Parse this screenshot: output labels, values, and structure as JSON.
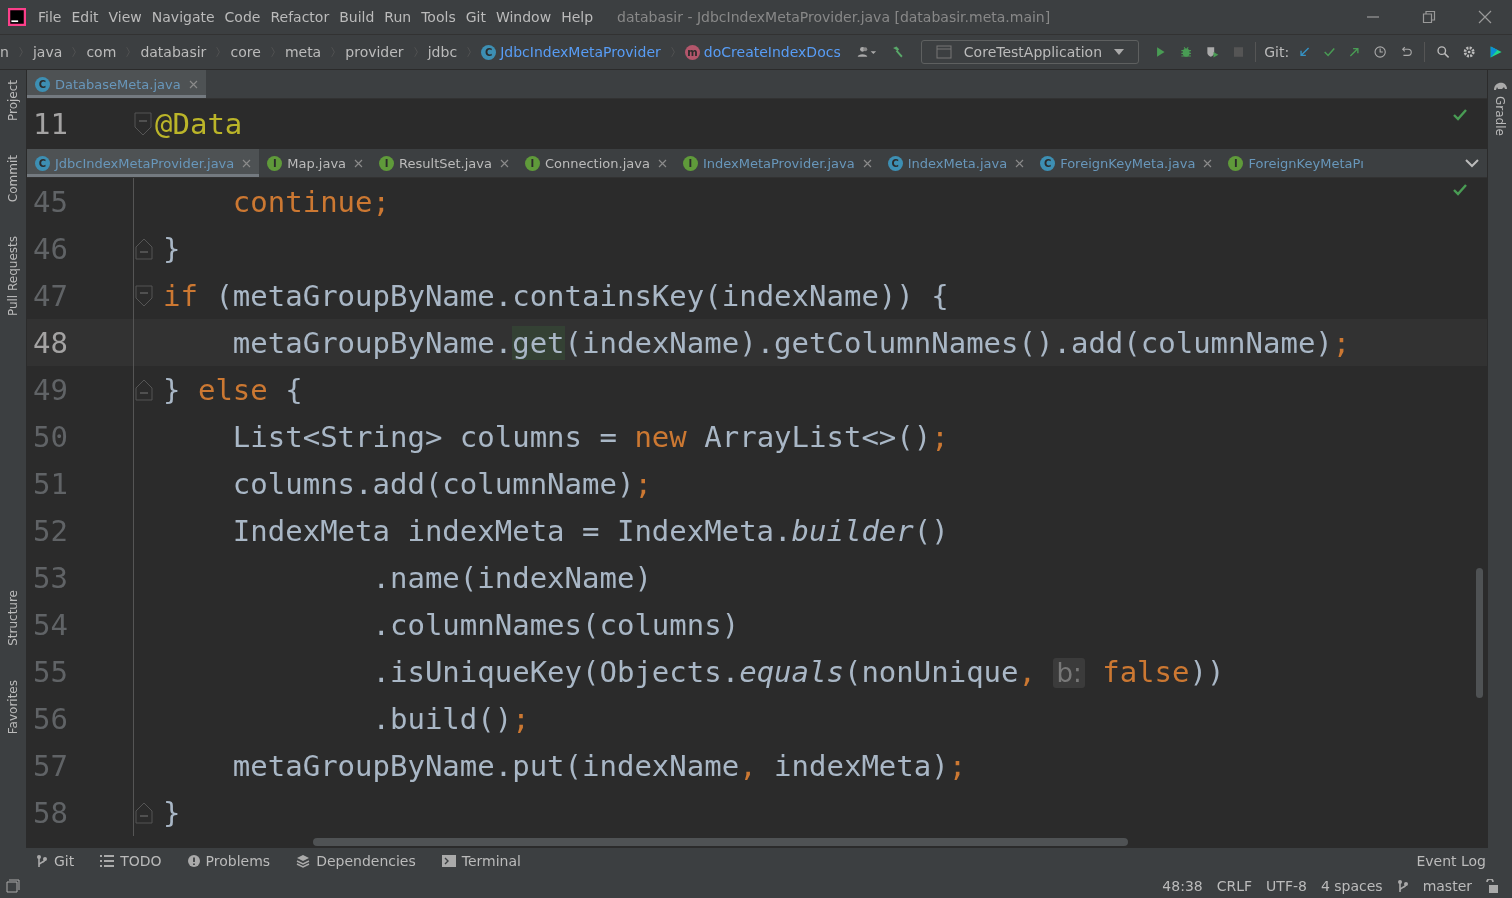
{
  "window": {
    "title": "databasir - JdbcIndexMetaProvider.java [databasir.meta.main]"
  },
  "menu": [
    "File",
    "Edit",
    "View",
    "Navigate",
    "Code",
    "Refactor",
    "Build",
    "Run",
    "Tools",
    "Git",
    "Window",
    "Help"
  ],
  "breadcrumbs": [
    {
      "label": "n",
      "kind": "folder"
    },
    {
      "label": "java",
      "kind": "folder"
    },
    {
      "label": "com",
      "kind": "folder"
    },
    {
      "label": "databasir",
      "kind": "folder"
    },
    {
      "label": "core",
      "kind": "folder"
    },
    {
      "label": "meta",
      "kind": "folder"
    },
    {
      "label": "provider",
      "kind": "folder"
    },
    {
      "label": "jdbc",
      "kind": "folder"
    },
    {
      "label": "JdbcIndexMetaProvider",
      "kind": "class",
      "badge": "C"
    },
    {
      "label": "doCreateIndexDocs",
      "kind": "method",
      "badge": "m"
    }
  ],
  "toolbar": {
    "run_configuration": "CoreTestApplication",
    "git_label": "Git:"
  },
  "left_tools": [
    "Project",
    "Commit",
    "Pull Requests",
    "Structure",
    "Favorites"
  ],
  "right_tools": [
    "Gradle"
  ],
  "top_editor": {
    "tabs": [
      {
        "label": "DatabaseMeta.java",
        "kind": "class",
        "badge": "C",
        "modified": true,
        "selected": true
      }
    ],
    "sticky_line": {
      "number": "11",
      "text": "@Data"
    }
  },
  "editor": {
    "tabs": [
      {
        "label": "JdbcIndexMetaProvider.java",
        "kind": "class",
        "badge": "C",
        "modified": true,
        "selected": true
      },
      {
        "label": "Map.java",
        "kind": "interface",
        "badge": "I",
        "modified": false,
        "selected": false
      },
      {
        "label": "ResultSet.java",
        "kind": "interface",
        "badge": "I",
        "modified": false,
        "selected": false
      },
      {
        "label": "Connection.java",
        "kind": "interface",
        "badge": "I",
        "modified": false,
        "selected": false
      },
      {
        "label": "IndexMetaProvider.java",
        "kind": "interface",
        "badge": "I",
        "modified": true,
        "selected": false
      },
      {
        "label": "IndexMeta.java",
        "kind": "class",
        "badge": "C",
        "modified": true,
        "selected": false
      },
      {
        "label": "ForeignKeyMeta.java",
        "kind": "class",
        "badge": "C",
        "modified": true,
        "selected": false
      },
      {
        "label": "ForeignKeyMetaPı",
        "kind": "interface",
        "badge": "I",
        "modified": true,
        "selected": false
      }
    ],
    "lines": [
      {
        "number": "45",
        "current": false,
        "tokens": [
          {
            "kind": "keyword",
            "text": "    continue"
          },
          {
            "kind": "keyword",
            "text": ";"
          }
        ]
      },
      {
        "number": "46",
        "current": false,
        "fold_end": true,
        "tokens": [
          {
            "kind": "plain",
            "text": "}"
          }
        ]
      },
      {
        "number": "47",
        "current": false,
        "fold_start": true,
        "tokens": [
          {
            "kind": "keyword",
            "text": "if"
          },
          {
            "kind": "plain",
            "text": " (metaGroupByName.containsKey(indexName)) {"
          }
        ]
      },
      {
        "number": "48",
        "current": true,
        "tokens": [
          {
            "kind": "plain",
            "text": "    metaGroupByName."
          },
          {
            "kind": "usage",
            "text": "get"
          },
          {
            "kind": "plain",
            "text": "(indexName).getColumnNames().add(columnName)"
          },
          {
            "kind": "keyword",
            "text": ";"
          }
        ]
      },
      {
        "number": "49",
        "current": false,
        "fold_end": true,
        "tokens": [
          {
            "kind": "plain",
            "text": "} "
          },
          {
            "kind": "keyword",
            "text": "else"
          },
          {
            "kind": "plain",
            "text": " {"
          }
        ]
      },
      {
        "number": "50",
        "current": false,
        "tokens": [
          {
            "kind": "plain",
            "text": "    List<String> columns = "
          },
          {
            "kind": "keyword",
            "text": "new"
          },
          {
            "kind": "plain",
            "text": " ArrayList<>()"
          },
          {
            "kind": "keyword",
            "text": ";"
          }
        ]
      },
      {
        "number": "51",
        "current": false,
        "tokens": [
          {
            "kind": "plain",
            "text": "    columns.add(columnName)"
          },
          {
            "kind": "keyword",
            "text": ";"
          }
        ]
      },
      {
        "number": "52",
        "current": false,
        "tokens": [
          {
            "kind": "plain",
            "text": "    IndexMeta indexMeta = IndexMeta."
          },
          {
            "kind": "static",
            "text": "builder"
          },
          {
            "kind": "plain",
            "text": "()"
          }
        ]
      },
      {
        "number": "53",
        "current": false,
        "tokens": [
          {
            "kind": "plain",
            "text": "            .name(indexName)"
          }
        ]
      },
      {
        "number": "54",
        "current": false,
        "tokens": [
          {
            "kind": "plain",
            "text": "            .columnNames(columns)"
          }
        ]
      },
      {
        "number": "55",
        "current": false,
        "tokens": [
          {
            "kind": "plain",
            "text": "            .isUniqueKey(Objects."
          },
          {
            "kind": "static",
            "text": "equals"
          },
          {
            "kind": "plain",
            "text": "(nonUnique"
          },
          {
            "kind": "keyword",
            "text": ", "
          },
          {
            "kind": "hint",
            "text": "b:"
          },
          {
            "kind": "keyword",
            "text": " false"
          },
          {
            "kind": "plain",
            "text": "))"
          }
        ]
      },
      {
        "number": "56",
        "current": false,
        "tokens": [
          {
            "kind": "plain",
            "text": "            .build()"
          },
          {
            "kind": "keyword",
            "text": ";"
          }
        ]
      },
      {
        "number": "57",
        "current": false,
        "tokens": [
          {
            "kind": "plain",
            "text": "    metaGroupByName.put(indexName"
          },
          {
            "kind": "keyword",
            "text": ","
          },
          {
            "kind": "plain",
            "text": " indexMeta)"
          },
          {
            "kind": "keyword",
            "text": ";"
          }
        ]
      },
      {
        "number": "58",
        "current": false,
        "fold_end": true,
        "tokens": [
          {
            "kind": "plain",
            "text": "}"
          }
        ]
      }
    ]
  },
  "bottom_tools": [
    {
      "label": "Git",
      "kind": "git"
    },
    {
      "label": "TODO",
      "kind": "todo"
    },
    {
      "label": "Problems",
      "kind": "problems"
    },
    {
      "label": "Dependencies",
      "kind": "dependencies"
    },
    {
      "label": "Terminal",
      "kind": "terminal"
    }
  ],
  "event_log": "Event Log",
  "status_bar": {
    "position": "48:38",
    "line_separator": "CRLF",
    "encoding": "UTF-8",
    "indent": "4 spaces",
    "branch": "master"
  }
}
